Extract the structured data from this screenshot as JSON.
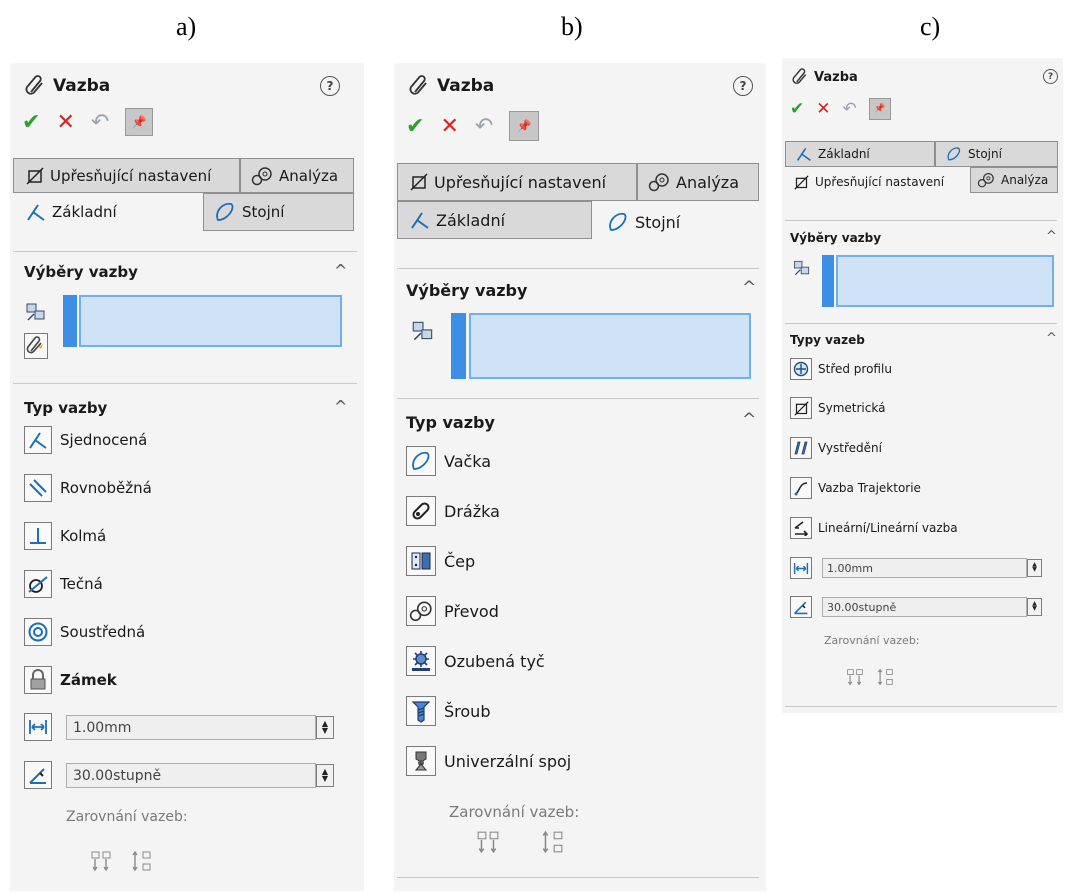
{
  "captions": [
    "a)",
    "b)",
    "c)"
  ],
  "panel_title": "Vazba",
  "help_glyph": "?",
  "actions": {
    "ok": "✔",
    "cancel": "✕",
    "undo": "↶",
    "pin": "📌"
  },
  "tabs": {
    "advanced": "Upřesňující nastavení",
    "analysis": "Analýza",
    "basic": "Základní",
    "mechanical": "Stojní"
  },
  "chevron": "^",
  "sections": {
    "selections": "Výběry vazby",
    "mate_type": "Typ vazby",
    "mate_types_c": "Typy vazeb"
  },
  "panel_a": {
    "items": [
      "Sjednocená",
      "Rovnoběžná",
      "Kolmá",
      "Tečná",
      "Soustředná",
      "Zámek"
    ],
    "distance": "1.00mm",
    "angle": "30.00stupně",
    "alignment_label": "Zarovnání vazeb:"
  },
  "panel_b": {
    "items": [
      "Vačka",
      "Drážka",
      "Čep",
      "Převod",
      "Ozubená tyč",
      "Šroub",
      "Univerzální spoj"
    ],
    "alignment_label": "Zarovnání vazeb:"
  },
  "panel_c": {
    "items": [
      "Střed profilu",
      "Symetrická",
      "Vystředění",
      "Vazba Trajektorie",
      "Lineární/Lineární vazba"
    ],
    "distance": "1.00mm",
    "angle": "30.00stupně",
    "alignment_label": "Zarovnání vazeb:"
  },
  "icons": {
    "title": "paperclip-icon",
    "a": [
      "coincident-icon",
      "parallel-icon",
      "perpendicular-icon",
      "tangent-icon",
      "concentric-icon",
      "lock-icon"
    ],
    "b": [
      "cam-icon",
      "slot-icon",
      "hinge-icon",
      "gear-icon",
      "rack-pinion-icon",
      "screw-icon",
      "universal-joint-icon"
    ],
    "c": [
      "profile-center-icon",
      "symmetric-icon",
      "width-icon",
      "path-mate-icon",
      "linear-coupler-icon"
    ]
  },
  "colors": {
    "ok": "#2aa12a",
    "cancel": "#e02020",
    "selection_fill": "#cfe2f7",
    "selection_bar": "#3d8fe6"
  }
}
